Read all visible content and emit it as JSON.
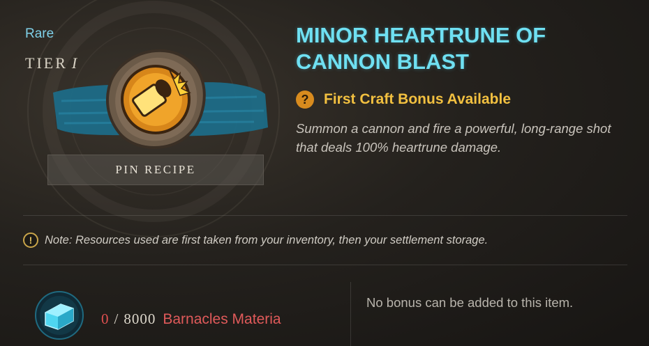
{
  "item": {
    "rarity": "Rare",
    "tier_label": "TIER",
    "tier_value": "I",
    "title": "MINOR HEARTRUNE OF CANNON BLAST",
    "first_craft_bonus": "First Craft Bonus Available",
    "description": "Summon a cannon and fire a powerful, long-range shot that deals 100% heartrune damage."
  },
  "actions": {
    "pin_recipe_label": "PIN RECIPE"
  },
  "note": {
    "text": "Note: Resources used are first taken from your inventory, then your settlement storage."
  },
  "materials": [
    {
      "have": "0",
      "separator": "/",
      "need": "8000",
      "name": "Barnacles Materia",
      "icon": "materia-crystal-icon"
    }
  ],
  "bonus": {
    "message": "No bonus can be added to this item."
  },
  "colors": {
    "rarity": "#7fd0e8",
    "title": "#6fe0f2",
    "bonus": "#f2c040",
    "insufficient": "#e05050"
  },
  "icons": {
    "item": "cannon-blast-rune-icon",
    "bonus": "question-icon",
    "note": "exclamation-icon"
  }
}
